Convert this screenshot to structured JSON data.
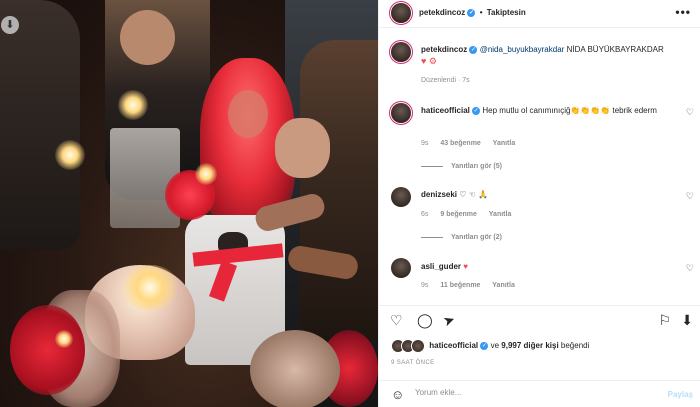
{
  "photo": {
    "download_icon": "download-arrow-icon"
  },
  "post_header": {
    "username": "petekdincoz",
    "separator": "•",
    "follow_label": "Takiptesin",
    "more_icon": "ellipsis-icon",
    "more_symbol": "•••"
  },
  "caption": {
    "username": "petekdincoz",
    "mention": "@nida_buyukbayrakdar",
    "text": "NİDA BÜYÜKBAYRAKDAR",
    "emoji": "♥ ⚙",
    "edited_time": "Düzenlendi · 7s"
  },
  "comments": [
    {
      "username": "haticeofficial",
      "verified": true,
      "text": "Hep mutlu ol canımınıçiğ👏👏👏👏 tebrik ederm",
      "time": "9s",
      "likes": "43 beğenme",
      "reply": "Yanıtla",
      "view_replies": "Yanıtları gör (5)"
    },
    {
      "username": "denizseki",
      "verified": false,
      "text": "♡ ☜ 🙏",
      "time": "6s",
      "likes": "9 beğenme",
      "reply": "Yanıtla",
      "view_replies": "Yanıtları gör (2)"
    },
    {
      "username": "asli_guder",
      "verified": false,
      "text": "♥",
      "time": "9s",
      "likes": "11 beğenme",
      "reply": "Yanıtla",
      "view_replies": ""
    }
  ],
  "actions": {
    "like_icon": "heart-icon",
    "comment_icon": "comment-icon",
    "share_icon": "share-icon",
    "save_icon": "bookmark-icon",
    "icons": [
      "♡",
      "◯",
      "➤",
      "⚐",
      "⬇"
    ]
  },
  "likes_summary": {
    "liker": "haticeofficial",
    "connector": "ve",
    "count_text": "9,997 diğer kişi",
    "suffix": "beğendi"
  },
  "posted_ago": "9 SAAT ÖNCE",
  "comment_box": {
    "placeholder": "Yorum ekle...",
    "post_label": "Paylaş",
    "emoji_icon": "smile-icon",
    "emoji_symbol": "☺"
  },
  "colors": {
    "verified": "#3897f0",
    "heart": "#ed4956",
    "link": "#00376b",
    "muted": "#8e8e8e",
    "post_button": "#b2dffc"
  }
}
